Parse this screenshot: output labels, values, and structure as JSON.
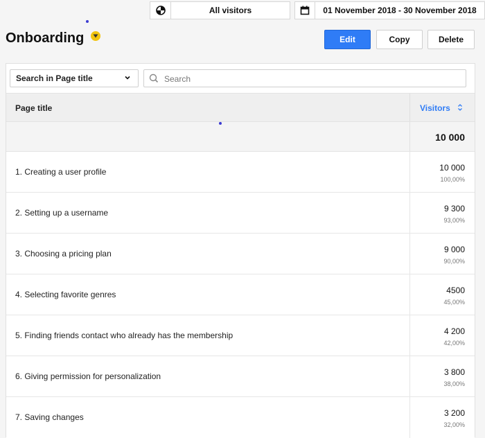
{
  "topbar": {
    "segment_label": "All visitors",
    "date_range": "01 November 2018 - 30 November 2018"
  },
  "header": {
    "title": "Onboarding",
    "buttons": {
      "edit": "Edit",
      "copy": "Copy",
      "delete": "Delete"
    }
  },
  "filter": {
    "select_value": "Search in Page title",
    "search_placeholder": "Search"
  },
  "table": {
    "col_title": "Page title",
    "col_visitors": "Visitors",
    "total": "10 000",
    "rows": [
      {
        "label": "1. Creating a user profile",
        "value": "10 000",
        "pct": "100,00%"
      },
      {
        "label": "2. Setting up a username",
        "value": "9 300",
        "pct": "93,00%"
      },
      {
        "label": "3. Choosing a pricing plan",
        "value": "9 000",
        "pct": "90,00%"
      },
      {
        "label": "4. Selecting favorite genres",
        "value": "4500",
        "pct": "45,00%"
      },
      {
        "label": "5. Finding friends contact who already has the membership",
        "value": "4 200",
        "pct": "42,00%"
      },
      {
        "label": "6. Giving permission for personalization",
        "value": "3 800",
        "pct": "38,00%"
      },
      {
        "label": "7. Saving changes",
        "value": "3 200",
        "pct": "32,00%"
      }
    ]
  },
  "colors": {
    "accent": "#2f7cf6",
    "badge": "#f2c40f"
  }
}
